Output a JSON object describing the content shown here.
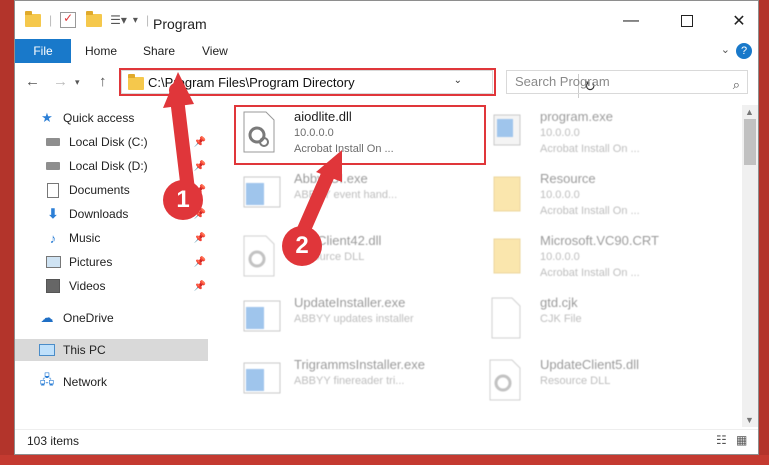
{
  "titlebar": {
    "title": "Program"
  },
  "ribbon": {
    "tabs": [
      "File",
      "Home",
      "Share",
      "View"
    ],
    "help": "?"
  },
  "nav": {
    "address": "C:\\Program Files\\Program Directory",
    "search_placeholder": "Search Program"
  },
  "sidebar": {
    "items": [
      {
        "label": "Quick access",
        "icon": "star-icon"
      },
      {
        "label": "Local Disk (C:)",
        "icon": "drive-icon",
        "pinned": true
      },
      {
        "label": "Local Disk (D:)",
        "icon": "drive-icon",
        "pinned": true
      },
      {
        "label": "Documents",
        "icon": "document-icon",
        "pinned": true
      },
      {
        "label": "Downloads",
        "icon": "download-icon",
        "pinned": true
      },
      {
        "label": "Music",
        "icon": "music-icon",
        "pinned": true
      },
      {
        "label": "Pictures",
        "icon": "picture-icon",
        "pinned": true
      },
      {
        "label": "Videos",
        "icon": "video-icon",
        "pinned": true
      },
      {
        "label": "OneDrive",
        "icon": "cloud-icon"
      },
      {
        "label": "This PC",
        "icon": "computer-icon"
      },
      {
        "label": "Network",
        "icon": "network-icon"
      }
    ]
  },
  "files": [
    {
      "name": "aiodlite.dll",
      "line1": "10.0.0.0",
      "line2": "Acrobat Install On ...",
      "icon": "dll-gear-icon"
    },
    {
      "name": "program.exe",
      "line1": "10.0.0.0",
      "line2": "Acrobat Install On ...",
      "icon": "exe-icon"
    },
    {
      "name": "AbbyyUI.exe",
      "line1": "ABBYY event hand...",
      "line2": "",
      "icon": "exe-icon"
    },
    {
      "name": "Resource",
      "line1": "10.0.0.0",
      "line2": "Acrobat Install On ...",
      "icon": "folder-icon"
    },
    {
      "name": "ResClient42.dll",
      "line1": "Resource DLL",
      "line2": "",
      "icon": "dll-gear-icon"
    },
    {
      "name": "Microsoft.VC90.CRT",
      "line1": "10.0.0.0",
      "line2": "Acrobat Install On ...",
      "icon": "folder-icon"
    },
    {
      "name": "UpdateInstaller.exe",
      "line1": "ABBYY updates installer",
      "line2": "",
      "icon": "exe-icon"
    },
    {
      "name": "gtd.cjk",
      "line1": "CJK File",
      "line2": "",
      "icon": "file-icon"
    },
    {
      "name": "TrigrammsInstaller.exe",
      "line1": "ABBYY finereader tri...",
      "line2": "",
      "icon": "exe-icon"
    },
    {
      "name": "UpdateClient5.dll",
      "line1": "Resource DLL",
      "line2": "",
      "icon": "dll-gear-icon"
    }
  ],
  "status": {
    "count": "103 items"
  },
  "callouts": {
    "one": "1",
    "two": "2"
  },
  "colors": {
    "accent": "#1979ca",
    "highlight": "#e0363a",
    "selected": "#cce8ff"
  }
}
